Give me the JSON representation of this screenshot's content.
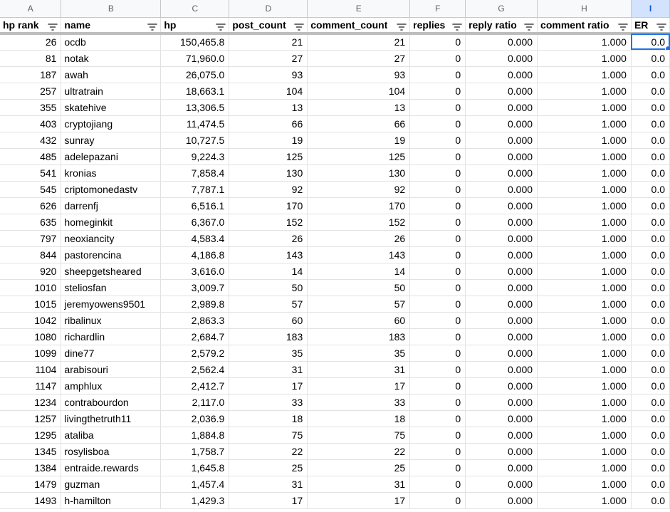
{
  "column_letters": [
    "A",
    "B",
    "C",
    "D",
    "E",
    "F",
    "G",
    "H",
    "I"
  ],
  "headers": [
    "hp rank",
    "name",
    "hp",
    "post_count",
    "comment_count",
    "replies",
    "reply ratio",
    "comment ratio",
    "ER"
  ],
  "active_cell": {
    "row": 0,
    "col": 8
  },
  "rows": [
    [
      "26",
      "ocdb",
      "150,465.8",
      "21",
      "21",
      "0",
      "0.000",
      "1.000",
      "0.0"
    ],
    [
      "81",
      "notak",
      "71,960.0",
      "27",
      "27",
      "0",
      "0.000",
      "1.000",
      "0.0"
    ],
    [
      "187",
      "awah",
      "26,075.0",
      "93",
      "93",
      "0",
      "0.000",
      "1.000",
      "0.0"
    ],
    [
      "257",
      "ultratrain",
      "18,663.1",
      "104",
      "104",
      "0",
      "0.000",
      "1.000",
      "0.0"
    ],
    [
      "355",
      "skatehive",
      "13,306.5",
      "13",
      "13",
      "0",
      "0.000",
      "1.000",
      "0.0"
    ],
    [
      "403",
      "cryptojiang",
      "11,474.5",
      "66",
      "66",
      "0",
      "0.000",
      "1.000",
      "0.0"
    ],
    [
      "432",
      "sunray",
      "10,727.5",
      "19",
      "19",
      "0",
      "0.000",
      "1.000",
      "0.0"
    ],
    [
      "485",
      "adelepazani",
      "9,224.3",
      "125",
      "125",
      "0",
      "0.000",
      "1.000",
      "0.0"
    ],
    [
      "541",
      "kronias",
      "7,858.4",
      "130",
      "130",
      "0",
      "0.000",
      "1.000",
      "0.0"
    ],
    [
      "545",
      "criptomonedastv",
      "7,787.1",
      "92",
      "92",
      "0",
      "0.000",
      "1.000",
      "0.0"
    ],
    [
      "626",
      "darrenfj",
      "6,516.1",
      "170",
      "170",
      "0",
      "0.000",
      "1.000",
      "0.0"
    ],
    [
      "635",
      "homeginkit",
      "6,367.0",
      "152",
      "152",
      "0",
      "0.000",
      "1.000",
      "0.0"
    ],
    [
      "797",
      "neoxiancity",
      "4,583.4",
      "26",
      "26",
      "0",
      "0.000",
      "1.000",
      "0.0"
    ],
    [
      "844",
      "pastorencina",
      "4,186.8",
      "143",
      "143",
      "0",
      "0.000",
      "1.000",
      "0.0"
    ],
    [
      "920",
      "sheepgetsheared",
      "3,616.0",
      "14",
      "14",
      "0",
      "0.000",
      "1.000",
      "0.0"
    ],
    [
      "1010",
      "steliosfan",
      "3,009.7",
      "50",
      "50",
      "0",
      "0.000",
      "1.000",
      "0.0"
    ],
    [
      "1015",
      "jeremyowens9501",
      "2,989.8",
      "57",
      "57",
      "0",
      "0.000",
      "1.000",
      "0.0"
    ],
    [
      "1042",
      "ribalinux",
      "2,863.3",
      "60",
      "60",
      "0",
      "0.000",
      "1.000",
      "0.0"
    ],
    [
      "1080",
      "richardlin",
      "2,684.7",
      "183",
      "183",
      "0",
      "0.000",
      "1.000",
      "0.0"
    ],
    [
      "1099",
      "dine77",
      "2,579.2",
      "35",
      "35",
      "0",
      "0.000",
      "1.000",
      "0.0"
    ],
    [
      "1104",
      "arabisouri",
      "2,562.4",
      "31",
      "31",
      "0",
      "0.000",
      "1.000",
      "0.0"
    ],
    [
      "1147",
      "amphlux",
      "2,412.7",
      "17",
      "17",
      "0",
      "0.000",
      "1.000",
      "0.0"
    ],
    [
      "1234",
      "contrabourdon",
      "2,117.0",
      "33",
      "33",
      "0",
      "0.000",
      "1.000",
      "0.0"
    ],
    [
      "1257",
      "livingthetruth11",
      "2,036.9",
      "18",
      "18",
      "0",
      "0.000",
      "1.000",
      "0.0"
    ],
    [
      "1295",
      "ataliba",
      "1,884.8",
      "75",
      "75",
      "0",
      "0.000",
      "1.000",
      "0.0"
    ],
    [
      "1345",
      "rosylisboa",
      "1,758.7",
      "22",
      "22",
      "0",
      "0.000",
      "1.000",
      "0.0"
    ],
    [
      "1384",
      "entraide.rewards",
      "1,645.8",
      "25",
      "25",
      "0",
      "0.000",
      "1.000",
      "0.0"
    ],
    [
      "1479",
      "guzman",
      "1,457.4",
      "31",
      "31",
      "0",
      "0.000",
      "1.000",
      "0.0"
    ],
    [
      "1493",
      "h-hamilton",
      "1,429.3",
      "17",
      "17",
      "0",
      "0.000",
      "1.000",
      "0.0"
    ]
  ]
}
